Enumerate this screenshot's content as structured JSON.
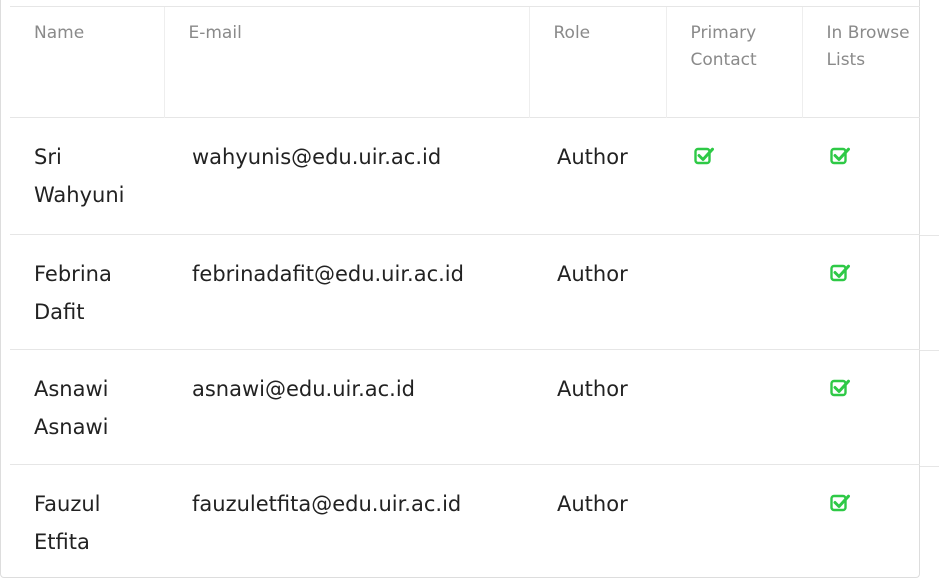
{
  "table": {
    "headers": {
      "name": "Name",
      "email": "E-mail",
      "role": "Role",
      "primary_contact": "Primary Contact",
      "in_browse_lists": "In Browse Lists"
    },
    "rows": [
      {
        "name": "Sri Wahyuni",
        "email": "wahyunis@edu.uir.ac.id",
        "role": "Author",
        "primary_contact": true,
        "in_browse_lists": true
      },
      {
        "name": "Febrina Dafit",
        "email": "febrinadafit@edu.uir.ac.id",
        "role": "Author",
        "primary_contact": false,
        "in_browse_lists": true
      },
      {
        "name": "Asnawi Asnawi",
        "email": "asnawi@edu.uir.ac.id",
        "role": "Author",
        "primary_contact": false,
        "in_browse_lists": true
      },
      {
        "name": "Fauzul Etfita",
        "email": "fauzuletfita@edu.uir.ac.id",
        "role": "Author",
        "primary_contact": false,
        "in_browse_lists": true
      }
    ]
  },
  "icons": {
    "checked": "check-square-icon"
  },
  "colors": {
    "check_green": "#2ec946",
    "header_text": "#8a8a8a",
    "body_text": "#222222"
  }
}
